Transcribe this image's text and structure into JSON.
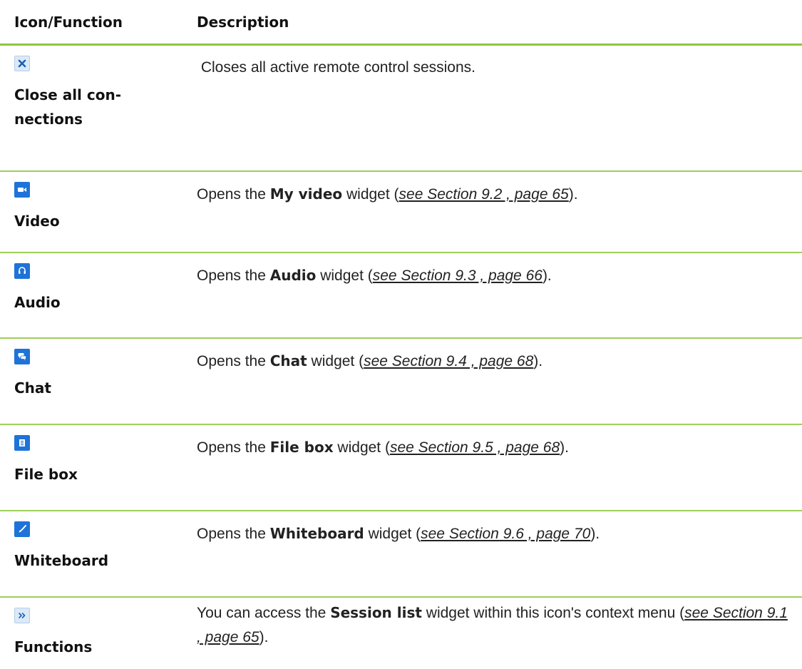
{
  "header": {
    "col1": "Icon/Function",
    "col2": "Description"
  },
  "rows": [
    {
      "icon": "close-icon",
      "label": "Close all con-nections",
      "label_lines": [
        "Close all con-",
        "nections"
      ],
      "desc_plain": " Closes all active remote control sessions."
    },
    {
      "icon": "video-camera-icon",
      "label": "Video",
      "desc_pre": "Opens the ",
      "desc_bold": "My video",
      "desc_mid": " widget (",
      "desc_ref": "see Section 9.2 , page 65",
      "desc_post": ")."
    },
    {
      "icon": "headset-icon",
      "label": "Audio",
      "desc_pre": "Opens the ",
      "desc_bold": "Audio",
      "desc_mid": " widget (",
      "desc_ref": "see Section 9.3 , page 66",
      "desc_post": ")."
    },
    {
      "icon": "chat-bubbles-icon",
      "label": "Chat",
      "desc_pre": "Opens the ",
      "desc_bold": "Chat",
      "desc_mid": " widget (",
      "desc_ref": "see Section 9.4 , page 68",
      "desc_post": ")."
    },
    {
      "icon": "file-box-icon",
      "label": "File box",
      "desc_pre": "Opens the ",
      "desc_bold": "File box",
      "desc_mid": " widget (",
      "desc_ref": "see Section 9.5 , page 68",
      "desc_post": ")."
    },
    {
      "icon": "paintbrush-icon",
      "label": "Whiteboard",
      "desc_pre": "Opens the ",
      "desc_bold": "Whiteboard",
      "desc_mid": " widget (",
      "desc_ref": "see Section 9.6 , page 70",
      "desc_post": ")."
    },
    {
      "icon": "double-chevron-right-icon",
      "label": "Functions",
      "desc_pre": "You can access the ",
      "desc_bold": "Session list",
      "desc_mid": " widget within this icon's context menu (",
      "desc_ref": "see Section 9.1 , page 65",
      "desc_post": ")."
    }
  ],
  "colors": {
    "divider": "#9fcf5a",
    "header_divider": "#8dc63f",
    "icon_blue": "#1e73d8",
    "icon_light": "#dbe9f8"
  }
}
